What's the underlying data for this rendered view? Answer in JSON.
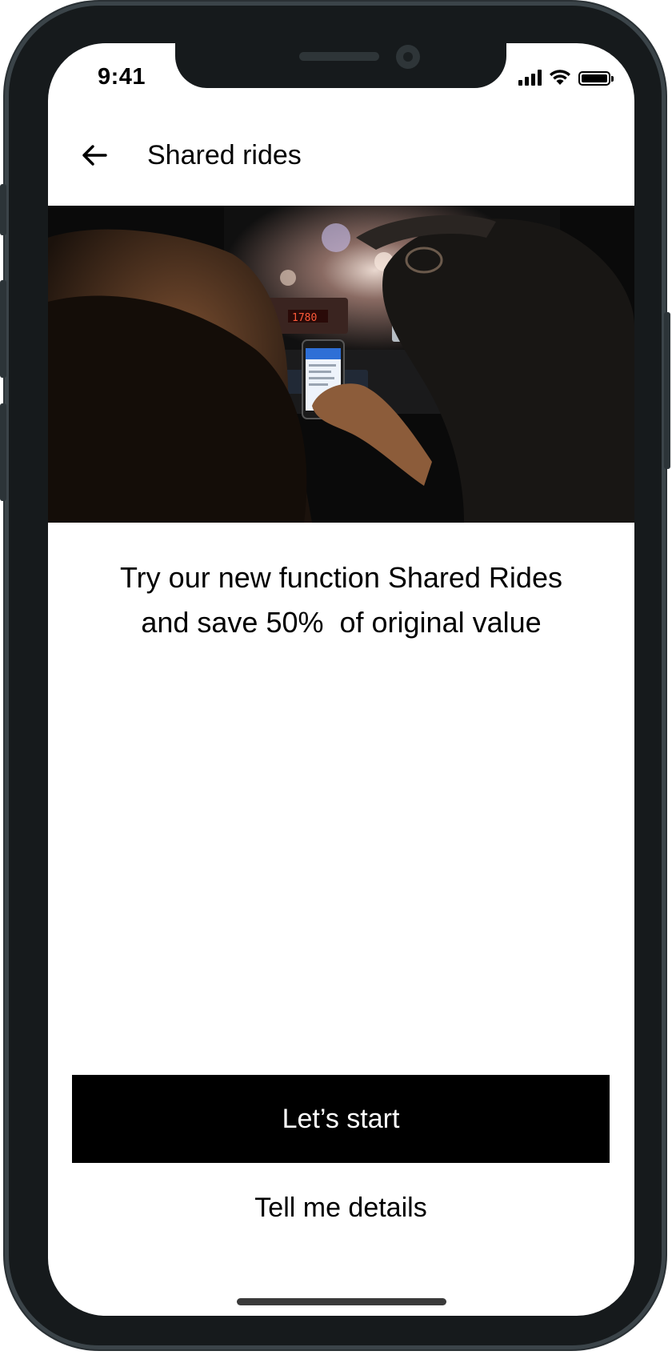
{
  "status_bar": {
    "time": "9:41"
  },
  "header": {
    "back_icon": "arrow-left-icon",
    "title": "Shared rides"
  },
  "hero": {
    "image": "photo of two people looking at a phone inside a taxi at night"
  },
  "promo": {
    "line1": "Try our new function Shared Rides",
    "line2": "and save 50%  of original value"
  },
  "actions": {
    "primary_label": "Let’s start",
    "secondary_label": "Tell me details"
  },
  "colors": {
    "primary_button_bg": "#000000",
    "primary_button_text": "#ffffff",
    "device_frame": "#161a1c"
  }
}
